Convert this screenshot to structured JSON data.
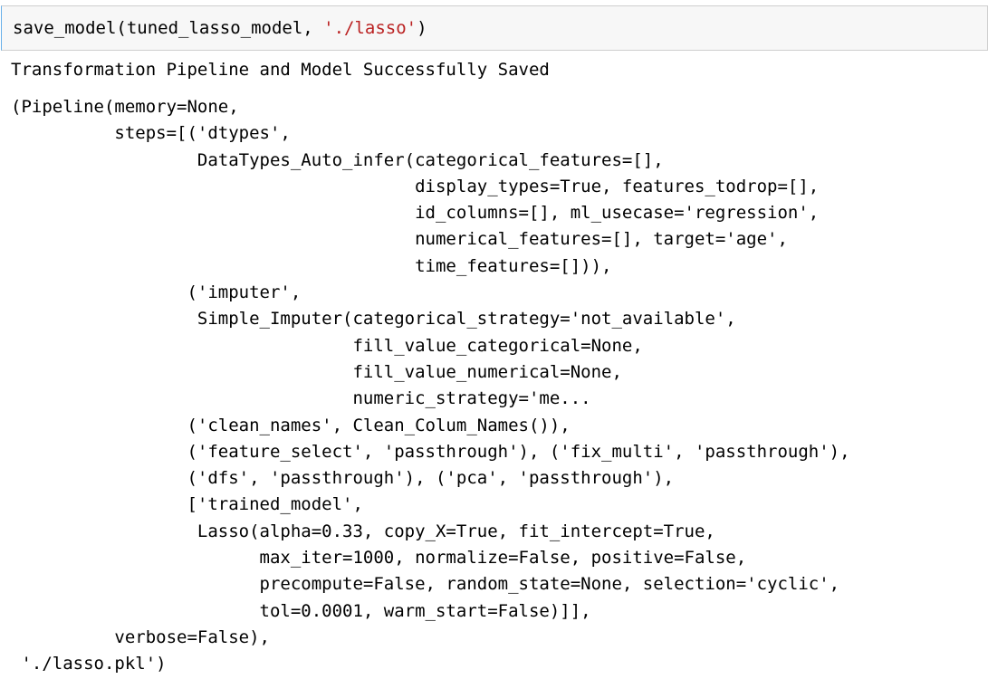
{
  "input_cell": {
    "code_prefix": "save_model(tuned_lasso_model, ",
    "code_string": "'./lasso'",
    "code_suffix": ")"
  },
  "output": {
    "message": "Transformation Pipeline and Model Successfully Saved",
    "lines": [
      "(Pipeline(memory=None,",
      "          steps=[('dtypes',",
      "                  DataTypes_Auto_infer(categorical_features=[],",
      "                                       display_types=True, features_todrop=[],",
      "                                       id_columns=[], ml_usecase='regression',",
      "                                       numerical_features=[], target='age',",
      "                                       time_features=[])),",
      "                 ('imputer',",
      "                  Simple_Imputer(categorical_strategy='not_available',",
      "                                 fill_value_categorical=None,",
      "                                 fill_value_numerical=None,",
      "                                 numeric_strategy='me...",
      "                 ('clean_names', Clean_Colum_Names()),",
      "                 ('feature_select', 'passthrough'), ('fix_multi', 'passthrough'),",
      "                 ('dfs', 'passthrough'), ('pca', 'passthrough'),",
      "                 ['trained_model',",
      "                  Lasso(alpha=0.33, copy_X=True, fit_intercept=True,",
      "                        max_iter=1000, normalize=False, positive=False,",
      "                        precompute=False, random_state=None, selection='cyclic',",
      "                        tol=0.0001, warm_start=False)]],",
      "          verbose=False),",
      " './lasso.pkl')"
    ]
  }
}
